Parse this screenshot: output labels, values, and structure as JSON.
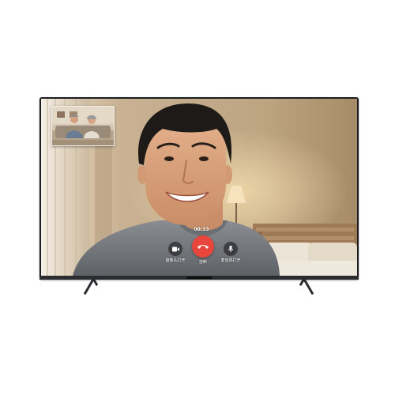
{
  "call": {
    "timer": "00:33",
    "camera_label": "摄像头打开",
    "hangup_label": "挂断",
    "mic_label": "麦克风打开"
  },
  "colors": {
    "hangup": "#e8453c",
    "control_bg": "#28282c",
    "tv_frame": "#1b1d20"
  },
  "icons": {
    "camera": "video-camera-icon",
    "hangup": "phone-hangup-icon",
    "mic": "microphone-icon"
  }
}
